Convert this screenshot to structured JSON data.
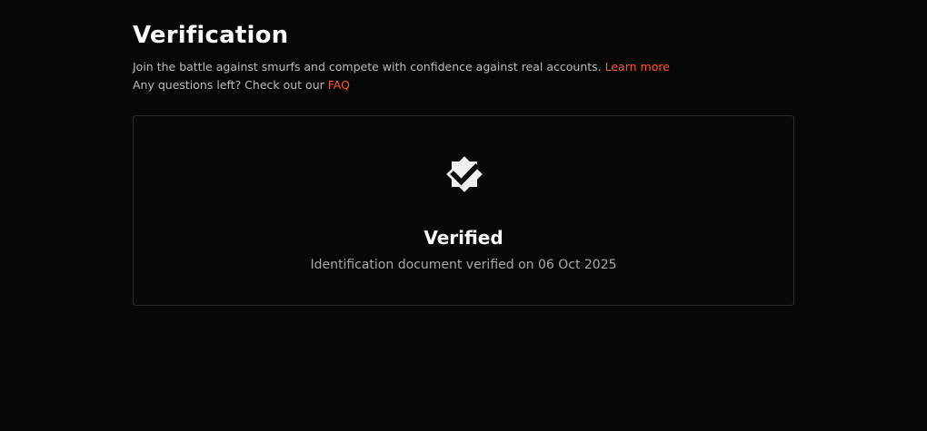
{
  "header": {
    "title": "Verification"
  },
  "intro": {
    "line1_text": "Join the battle against smurfs and compete with confidence against real accounts. ",
    "learn_more_label": "Learn more",
    "line2_text": "Any questions left? Check out our ",
    "faq_label": "FAQ"
  },
  "status_card": {
    "icon": "verified-badge-icon",
    "title": "Verified",
    "description": "Identification document verified on 06 Oct 2025"
  },
  "colors": {
    "background": "#060606",
    "accent_link": "#ff5a36",
    "card_border": "#2b2b2b",
    "badge_fill": "#f0f0f0"
  }
}
